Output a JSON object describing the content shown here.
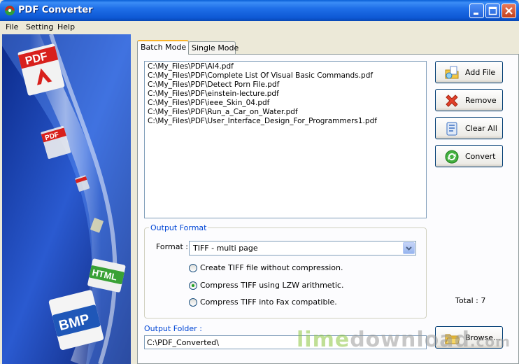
{
  "window": {
    "title": "PDF Converter"
  },
  "menu": [
    "File",
    "Setting",
    "Help"
  ],
  "tabs": [
    {
      "label": "Batch Mode"
    },
    {
      "label": "Single Mode"
    }
  ],
  "files": [
    "C:\\My_Files\\PDF\\AI4.pdf",
    "C:\\My_Files\\PDF\\Complete List Of Visual Basic Commands.pdf",
    "C:\\My_Files\\PDF\\Detect Porn File.pdf",
    "C:\\My_Files\\PDF\\einstein-lecture.pdf",
    "C:\\My_Files\\PDF\\ieee_Skin_04.pdf",
    "C:\\My_Files\\PDF\\Run_a_Car_on_Water.pdf",
    "C:\\My_Files\\PDF\\User_Interface_Design_For_Programmers1.pdf"
  ],
  "buttons": {
    "add": "Add File",
    "remove": "Remove",
    "clear": "Clear All",
    "convert": "Convert",
    "browse": "Browse..."
  },
  "output_format": {
    "title": "Output Format",
    "format_label": "Format :",
    "selected": "TIFF - multi page",
    "options": [
      {
        "label": "Create TIFF file without compression.",
        "checked": false
      },
      {
        "label": "Compress TIFF using LZW arithmetic.",
        "checked": true
      },
      {
        "label": "Compress TIFF into Fax compatible.",
        "checked": false
      }
    ]
  },
  "total": "Total : 7",
  "output_folder": {
    "label": "Output Folder :",
    "value": "C:\\PDF_Converted\\"
  },
  "sidebar": {
    "badges": [
      "PDF",
      "PDF",
      "HTML",
      "BMP"
    ]
  },
  "watermark": {
    "part1": "lime",
    "part2": "download",
    "part3": ".com"
  },
  "colors": {
    "title_bar": "#0a5fd6",
    "group_title": "#0046d5",
    "watermark_green": "#8cc63f",
    "watermark_gray": "#9a9a9a"
  }
}
